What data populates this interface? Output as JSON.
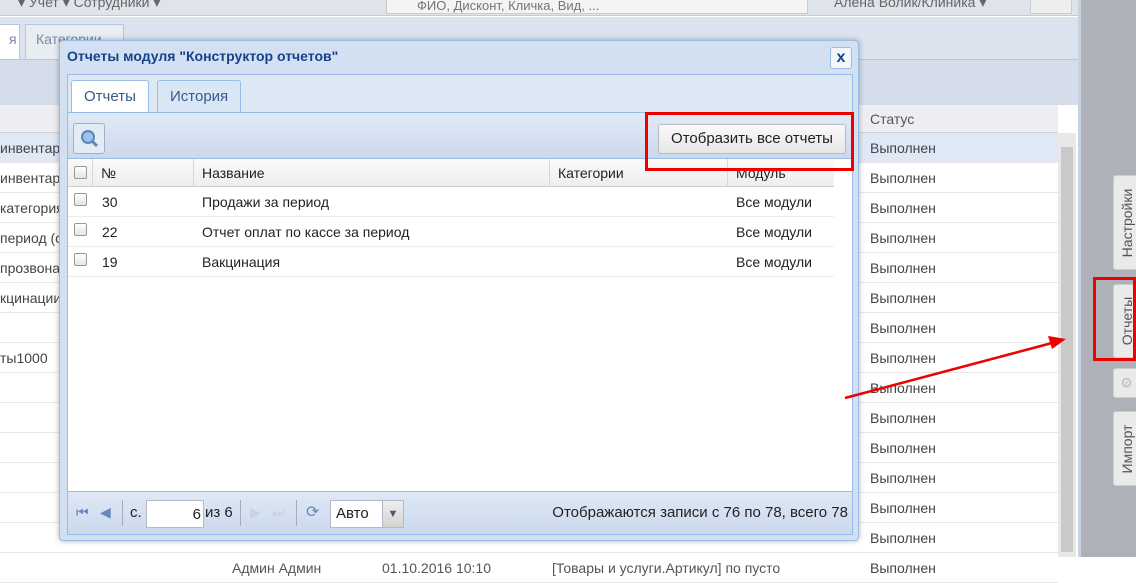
{
  "topbar": {
    "menu": "▾ Учет ▾ Сотрудники ▾",
    "search_placeholder": "ФИО, Дисконт, Кличка, Вид, ...",
    "user": "Алена Волик/Клиника ▾"
  },
  "bg_tabs": [
    "я",
    "Категории"
  ],
  "bg_grid": {
    "status_header": "Статус",
    "rows": [
      {
        "left": "инвентар",
        "status": "Выполнен"
      },
      {
        "left": "инвентар",
        "status": "Выполнен"
      },
      {
        "left": "категория",
        "status": "Выполнен"
      },
      {
        "left": "период (с",
        "status": "Выполнен"
      },
      {
        "left": "прозвона",
        "status": "Выполнен"
      },
      {
        "left": "кцинации",
        "status": "Выполнен"
      },
      {
        "left": "",
        "status": "Выполнен"
      },
      {
        "left": "ты1000",
        "status": "Выполнен"
      },
      {
        "left": "",
        "status": "Выполнен"
      },
      {
        "left": "",
        "status": "Выполнен"
      },
      {
        "left": "",
        "status": "Выполнен"
      },
      {
        "left": "",
        "status": "Выполнен"
      },
      {
        "left": "",
        "status": "Выполнен"
      },
      {
        "left": "",
        "status": "Выполнен"
      }
    ],
    "last_row": {
      "user": "Админ Админ",
      "date": "01.10.2016 10:10",
      "desc": "[Товары и услуги.Артикул] по пусто",
      "status": "Выполнен"
    }
  },
  "sidebar": {
    "items": [
      "Настройки",
      "Отчеты",
      "Импорт"
    ]
  },
  "modal": {
    "title": "Отчеты модуля \"Конструктор отчетов\"",
    "close": "x",
    "tabs": [
      "Отчеты",
      "История"
    ],
    "show_all_button": "Отобразить все отчеты",
    "columns": [
      "№",
      "Название",
      "Категории",
      "Модуль"
    ],
    "rows": [
      {
        "num": "30",
        "name": "Продажи за период",
        "category": "",
        "module": "Все модули"
      },
      {
        "num": "22",
        "name": "Отчет оплат по кассе за период",
        "category": "",
        "module": "Все модули"
      },
      {
        "num": "19",
        "name": "Вакцинация",
        "category": "",
        "module": "Все модули"
      }
    ],
    "pager": {
      "page_label": "с.",
      "page": "6",
      "of": "из 6",
      "page_size": "Авто",
      "info": "Отображаются записи с 76 по 78, всего 78"
    }
  }
}
